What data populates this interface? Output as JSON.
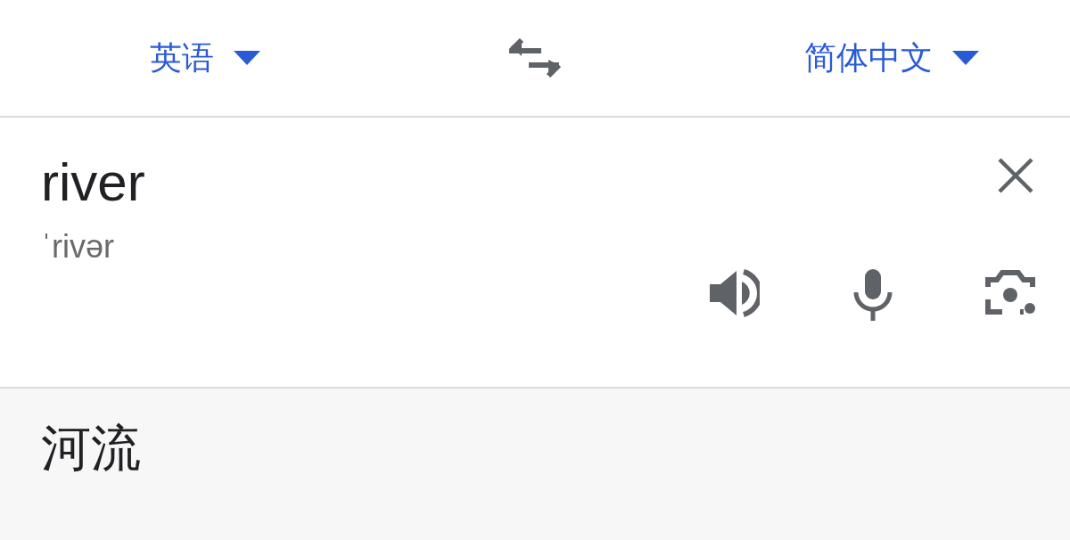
{
  "language_bar": {
    "source_language": "英语",
    "target_language": "简体中文"
  },
  "input": {
    "value": "river",
    "phonetic": "ˈrivər"
  },
  "translation": {
    "text": "河流"
  }
}
